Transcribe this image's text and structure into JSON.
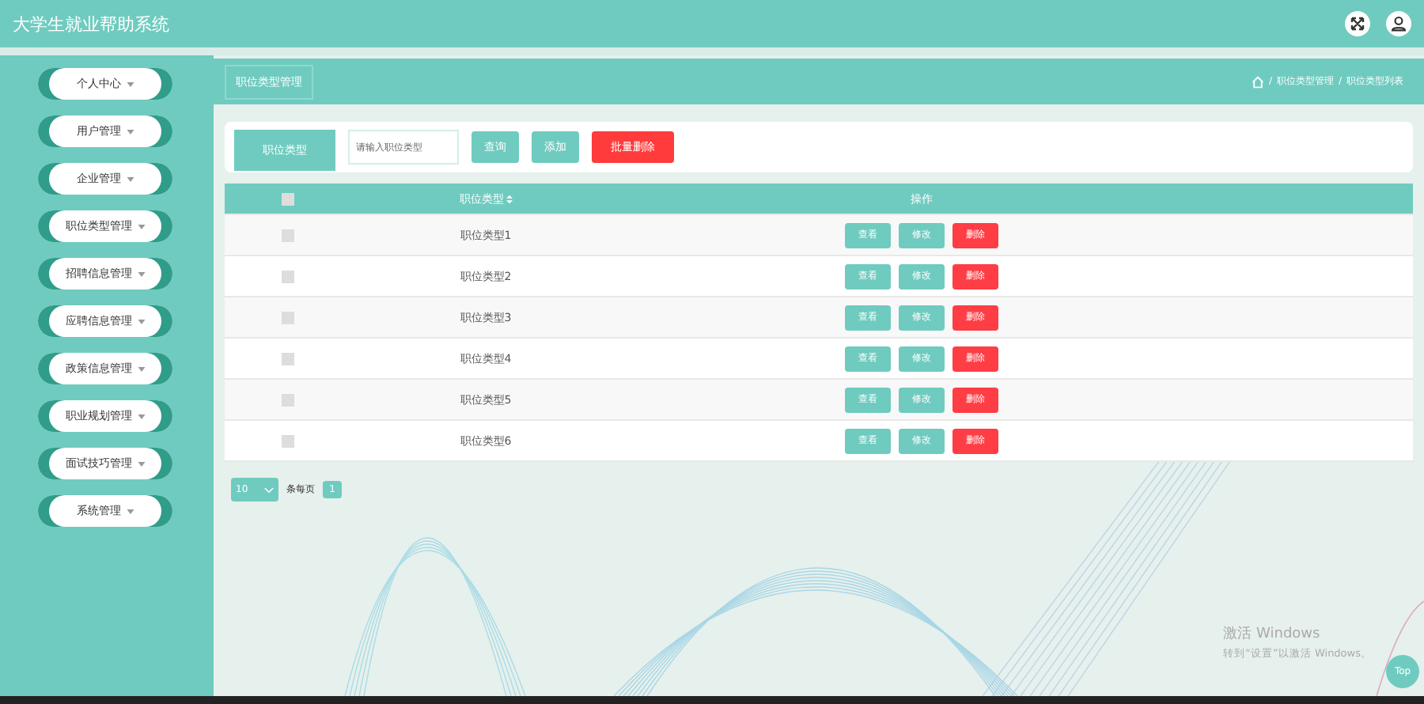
{
  "header": {
    "title": "大学生就业帮助系统"
  },
  "sidebar": {
    "items": [
      {
        "label": "个人中心"
      },
      {
        "label": "用户管理"
      },
      {
        "label": "企业管理"
      },
      {
        "label": "职位类型管理"
      },
      {
        "label": "招聘信息管理"
      },
      {
        "label": "应聘信息管理"
      },
      {
        "label": "政策信息管理"
      },
      {
        "label": "职业规划管理"
      },
      {
        "label": "面试技巧管理"
      },
      {
        "label": "系统管理"
      }
    ]
  },
  "page_title": "职位类型管理",
  "breadcrumb": {
    "separator": "/",
    "items": [
      "职位类型管理",
      "职位类型列表"
    ]
  },
  "search": {
    "label": "职位类型",
    "placeholder": "请输入职位类型",
    "buttons": [
      {
        "label": "查询",
        "kind": "primary"
      },
      {
        "label": "添加",
        "kind": "primary"
      },
      {
        "label": "批量删除",
        "kind": "danger"
      }
    ]
  },
  "table": {
    "select_all": {
      "checked": false
    },
    "columns": [
      "职位类型",
      "操作"
    ],
    "rows": [
      {
        "checked": false,
        "name": "职位类型1",
        "actions": [
          {
            "label": "查看",
            "kind": "primary"
          },
          {
            "label": "修改",
            "kind": "primary"
          },
          {
            "label": "删除",
            "kind": "danger"
          }
        ]
      },
      {
        "checked": false,
        "name": "职位类型2",
        "actions": [
          {
            "label": "查看",
            "kind": "primary"
          },
          {
            "label": "修改",
            "kind": "primary"
          },
          {
            "label": "删除",
            "kind": "danger"
          }
        ]
      },
      {
        "checked": false,
        "name": "职位类型3",
        "actions": [
          {
            "label": "查看",
            "kind": "primary"
          },
          {
            "label": "修改",
            "kind": "primary"
          },
          {
            "label": "删除",
            "kind": "danger"
          }
        ]
      },
      {
        "checked": false,
        "name": "职位类型4",
        "actions": [
          {
            "label": "查看",
            "kind": "primary"
          },
          {
            "label": "修改",
            "kind": "primary"
          },
          {
            "label": "删除",
            "kind": "danger"
          }
        ]
      },
      {
        "checked": false,
        "name": "职位类型5",
        "actions": [
          {
            "label": "查看",
            "kind": "primary"
          },
          {
            "label": "修改",
            "kind": "primary"
          },
          {
            "label": "删除",
            "kind": "danger"
          }
        ]
      },
      {
        "checked": false,
        "name": "职位类型6",
        "actions": [
          {
            "label": "查看",
            "kind": "primary"
          },
          {
            "label": "修改",
            "kind": "primary"
          },
          {
            "label": "删除",
            "kind": "danger"
          }
        ]
      }
    ]
  },
  "pagination": {
    "page_size": "10",
    "page_size_label": "条每页",
    "pages": [
      {
        "label": "1",
        "selected": true
      }
    ]
  },
  "activation_notice": {
    "title": "激活 Windows",
    "text": "转到“设置”以激活 Windows。"
  },
  "top_button": "Top"
}
